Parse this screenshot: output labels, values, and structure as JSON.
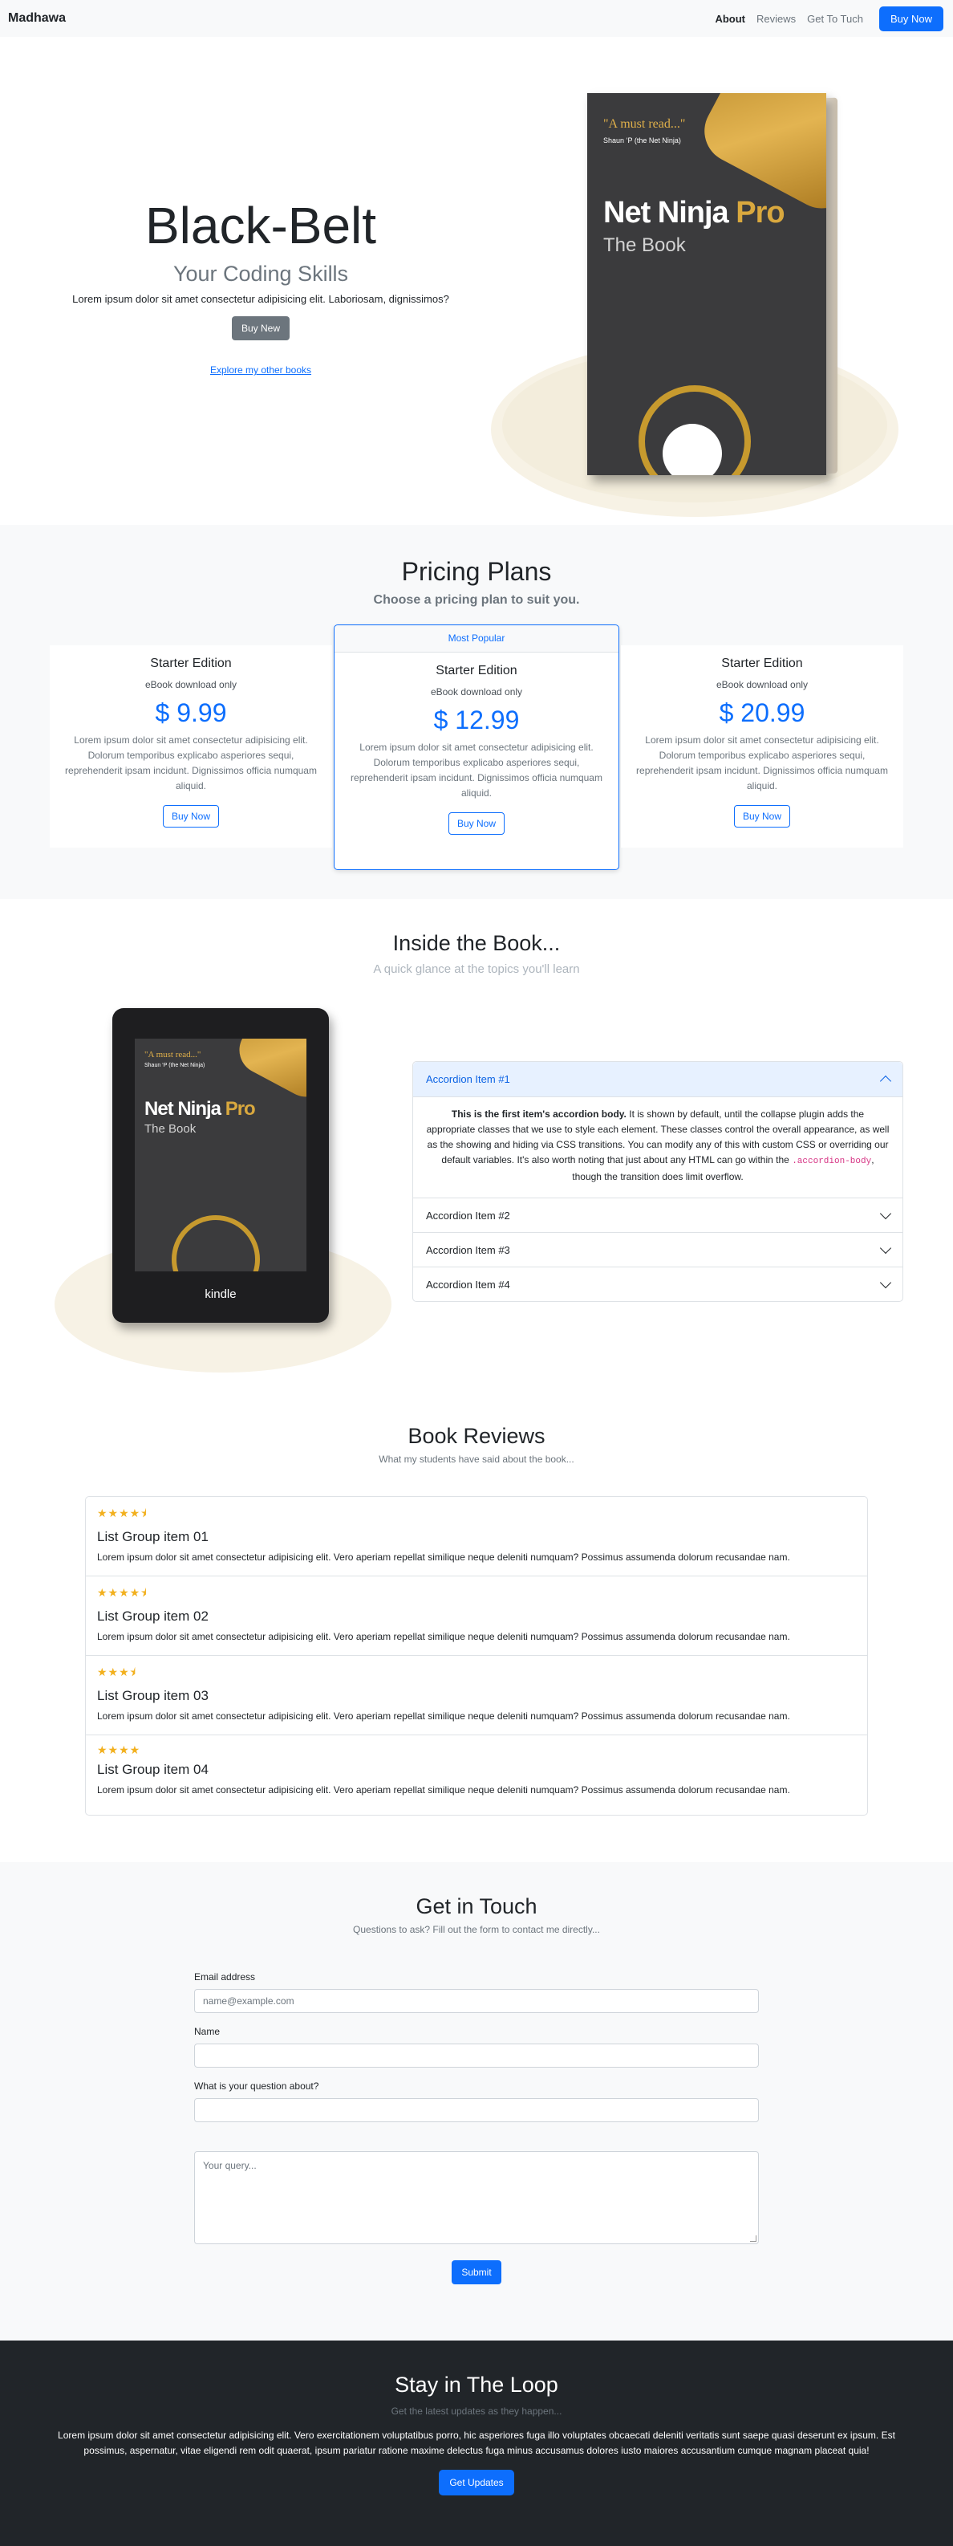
{
  "nav": {
    "brand": "Madhawa",
    "links": [
      "About",
      "Reviews",
      "Get To Tuch"
    ],
    "cta": "Buy Now"
  },
  "hero": {
    "title": "Black-Belt",
    "subtitle": "Your Coding Skills",
    "lead": "Lorem ipsum dolor sit amet consectetur adipisicing elit. Laboriosam, dignissimos?",
    "button": "Buy New",
    "link": "Explore my other books"
  },
  "book": {
    "quote": "\"A must read...\"",
    "author": "Shaun ‘P (the Net Ninja)",
    "title_main": "Net Ninja ",
    "title_pro": "Pro",
    "subtitle": "The Book"
  },
  "pricing": {
    "title": "Pricing Plans",
    "subtitle": "Choose a pricing plan to suit you.",
    "plans": [
      {
        "title": "Starter Edition",
        "sub": "eBook download only",
        "price": "$ 9.99",
        "text": "Lorem ipsum dolor sit amet consectetur adipisicing elit. Dolorum temporibus explicabo asperiores sequi, reprehenderit ipsam incidunt. Dignissimos officia numquam aliquid.",
        "button": "Buy Now"
      },
      {
        "badge": "Most Popular",
        "title": "Starter Edition",
        "sub": "eBook download only",
        "price": "$ 12.99",
        "text": "Lorem ipsum dolor sit amet consectetur adipisicing elit. Dolorum temporibus explicabo asperiores sequi, reprehenderit ipsam incidunt. Dignissimos officia numquam aliquid.",
        "button": "Buy Now"
      },
      {
        "title": "Starter Edition",
        "sub": "eBook download only",
        "price": "$ 20.99",
        "text": "Lorem ipsum dolor sit amet consectetur adipisicing elit. Dolorum temporibus explicabo asperiores sequi, reprehenderit ipsam incidunt. Dignissimos officia numquam aliquid.",
        "button": "Buy Now"
      }
    ]
  },
  "inside": {
    "title": "Inside the Book...",
    "subtitle": "A quick glance at the topics you'll learn",
    "kindle_label": "kindle",
    "accordion": [
      {
        "label": "Accordion Item #1",
        "open": true,
        "body_strong": "This is the first item's accordion body.",
        "body_text": " It is shown by default, until the collapse plugin adds the appropriate classes that we use to style each element. These classes control the overall appearance, as well as the showing and hiding via CSS transitions. You can modify any of this with custom CSS or overriding our default variables. It's also worth noting that just about any HTML can go within the ",
        "body_code": ".accordion-body",
        "body_end": ", though the transition does limit overflow."
      },
      {
        "label": "Accordion Item #2",
        "open": false
      },
      {
        "label": "Accordion Item #3",
        "open": false
      },
      {
        "label": "Accordion Item #4",
        "open": false
      }
    ]
  },
  "reviews": {
    "title": "Book Reviews",
    "subtitle": "What my students have said about the book...",
    "items": [
      {
        "stars": "★★★★⯨",
        "rating": 4.5,
        "title": "List Group item 01",
        "text": "Lorem ipsum dolor sit amet consectetur adipisicing elit. Vero aperiam repellat similique neque deleniti numquam? Possimus assumenda dolorum recusandae nam."
      },
      {
        "stars": "★★★★⯨",
        "rating": 4.5,
        "title": "List Group item 02",
        "text": "Lorem ipsum dolor sit amet consectetur adipisicing elit. Vero aperiam repellat similique neque deleniti numquam? Possimus assumenda dolorum recusandae nam."
      },
      {
        "stars": "★★★⯨",
        "rating": 3.5,
        "title": "List Group item 03",
        "text": "Lorem ipsum dolor sit amet consectetur adipisicing elit. Vero aperiam repellat similique neque deleniti numquam? Possimus assumenda dolorum recusandae nam."
      },
      {
        "stars": "★★★★",
        "rating": 4,
        "title": "List Group item 04",
        "text": "Lorem ipsum dolor sit amet consectetur adipisicing elit. Vero aperiam repellat similique neque deleniti numquam? Possimus assumenda dolorum recusandae nam."
      }
    ]
  },
  "contact": {
    "title": "Get in Touch",
    "subtitle": "Questions to ask? Fill out the form to contact me directly...",
    "email_label": "Email address",
    "email_placeholder": "name@example.com",
    "name_label": "Name",
    "question_label": "What is your question about?",
    "query_placeholder": "Your query...",
    "submit": "Submit"
  },
  "loop": {
    "title": "Stay in The Loop",
    "subtitle": "Get the latest updates as they happen...",
    "text": "Lorem ipsum dolor sit amet consectetur adipisicing elit. Vero exercitationem voluptatibus porro, hic asperiores fuga illo voluptates obcaecati deleniti veritatis sunt saepe quasi deserunt ex ipsum. Est possimus, aspernatur, vitae eligendi rem odit quaerat, ipsum pariatur ratione maxime delectus fuga minus accusamus dolores iusto maiores accusantium cumque magnam placeat quia!",
    "button": "Get Updates"
  },
  "colors": {
    "primary": "#0d6efd",
    "gold": "#d9a83e",
    "dark": "#212529",
    "light": "#f8f9fa",
    "star": "#f2b01e"
  }
}
